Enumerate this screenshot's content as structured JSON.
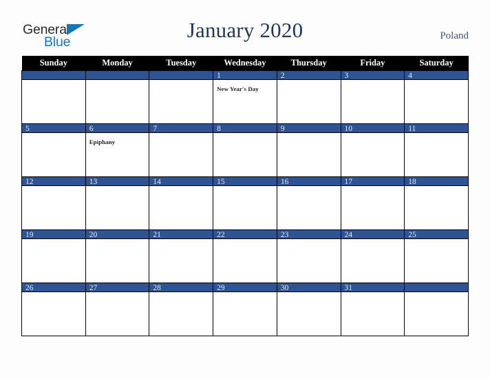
{
  "brand": {
    "name_part1": "General",
    "name_part2": "Blue",
    "triangle_icon": "triangle-icon",
    "primary_color": "#1278be",
    "text_color": "#2b2b2b"
  },
  "header": {
    "title": "January 2020",
    "country": "Poland",
    "title_color": "#21375e",
    "country_color": "#3d5480"
  },
  "calendar": {
    "month": "January",
    "year": "2020",
    "header_bg": "#000000",
    "daybar_bg": "#2e5494",
    "daybar_text_color": "#e8edf5",
    "grid_line_color": "#000000",
    "weekday_headers": [
      "Sunday",
      "Monday",
      "Tuesday",
      "Wednesday",
      "Thursday",
      "Friday",
      "Saturday"
    ],
    "weeks": [
      [
        {
          "day": "",
          "event": ""
        },
        {
          "day": "",
          "event": ""
        },
        {
          "day": "",
          "event": ""
        },
        {
          "day": "1",
          "event": "New Year's Day"
        },
        {
          "day": "2",
          "event": ""
        },
        {
          "day": "3",
          "event": ""
        },
        {
          "day": "4",
          "event": ""
        }
      ],
      [
        {
          "day": "5",
          "event": ""
        },
        {
          "day": "6",
          "event": "Epiphany"
        },
        {
          "day": "7",
          "event": ""
        },
        {
          "day": "8",
          "event": ""
        },
        {
          "day": "9",
          "event": ""
        },
        {
          "day": "10",
          "event": ""
        },
        {
          "day": "11",
          "event": ""
        }
      ],
      [
        {
          "day": "12",
          "event": ""
        },
        {
          "day": "13",
          "event": ""
        },
        {
          "day": "14",
          "event": ""
        },
        {
          "day": "15",
          "event": ""
        },
        {
          "day": "16",
          "event": ""
        },
        {
          "day": "17",
          "event": ""
        },
        {
          "day": "18",
          "event": ""
        }
      ],
      [
        {
          "day": "19",
          "event": ""
        },
        {
          "day": "20",
          "event": ""
        },
        {
          "day": "21",
          "event": ""
        },
        {
          "day": "22",
          "event": ""
        },
        {
          "day": "23",
          "event": ""
        },
        {
          "day": "24",
          "event": ""
        },
        {
          "day": "25",
          "event": ""
        }
      ],
      [
        {
          "day": "26",
          "event": ""
        },
        {
          "day": "27",
          "event": ""
        },
        {
          "day": "28",
          "event": ""
        },
        {
          "day": "29",
          "event": ""
        },
        {
          "day": "30",
          "event": ""
        },
        {
          "day": "31",
          "event": ""
        },
        {
          "day": "",
          "event": ""
        }
      ]
    ]
  }
}
